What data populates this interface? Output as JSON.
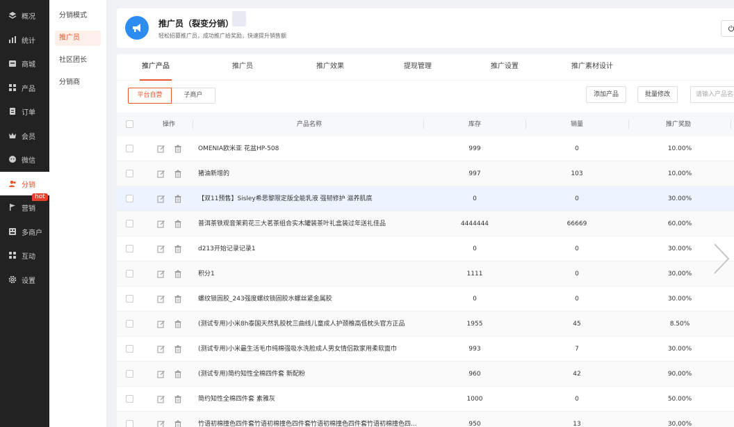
{
  "nav": {
    "items": [
      {
        "label": "概况",
        "icon": "layers-icon"
      },
      {
        "label": "统计",
        "icon": "stats-icon"
      },
      {
        "label": "商城",
        "icon": "shop-icon"
      },
      {
        "label": "产品",
        "icon": "grid-icon"
      },
      {
        "label": "订单",
        "icon": "order-icon"
      },
      {
        "label": "会员",
        "icon": "crown-icon"
      },
      {
        "label": "微信",
        "icon": "chat-icon"
      },
      {
        "label": "分销",
        "icon": "users-icon"
      },
      {
        "label": "营销",
        "icon": "flag-icon"
      },
      {
        "label": "多商户",
        "icon": "store-icon"
      },
      {
        "label": "互动",
        "icon": "apps-icon"
      },
      {
        "label": "设置",
        "icon": "gear-icon"
      }
    ],
    "hot_badge": "hot",
    "active_color": "#e8572b"
  },
  "submenu": {
    "items": [
      "分销模式",
      "推广员",
      "社区团长",
      "分销商"
    ]
  },
  "header": {
    "title": "推广员（裂变分销）",
    "desc": "轻松招募推广员，成功推广给奖励，快速提升销售额"
  },
  "tabs": [
    "推广产品",
    "推广员",
    "推广效果",
    "提现管理",
    "推广设置",
    "推广素材设计"
  ],
  "filters": {
    "segment": [
      "平台自营",
      "子商户"
    ],
    "add_button": "添加产品",
    "batch_button": "批量修改",
    "search_placeholder": "请输入产品名称"
  },
  "table": {
    "headers": {
      "op": "操作",
      "name": "产品名称",
      "stock": "库存",
      "sales": "销量",
      "reward": "推广奖励"
    },
    "rows": [
      {
        "name": "OMENIA欧米亚 花盆HP-508",
        "stock": "999",
        "sales": "0",
        "reward": "10.00%"
      },
      {
        "name": "猪油新增的",
        "stock": "997",
        "sales": "103",
        "reward": "10.00%"
      },
      {
        "name": "【双11预售】Sisley希思黎限定版全能乳液 强韧修护 滋养肌底",
        "stock": "0",
        "sales": "0",
        "reward": "30.00%"
      },
      {
        "name": "普洱茶铁观音茉莉花三大茗茶组合实木罐装茶叶礼盒装过年送礼佳品",
        "stock": "4444444",
        "sales": "66669",
        "reward": "60.00%"
      },
      {
        "name": "d213开始记录记录1",
        "stock": "0",
        "sales": "0",
        "reward": "30.00%"
      },
      {
        "name": "积分1",
        "stock": "1111",
        "sales": "0",
        "reward": "30.00%"
      },
      {
        "name": "螺纹锁固胶_243强度螺纹锁固胶水螺丝紧金属胶",
        "stock": "0",
        "sales": "0",
        "reward": "30.00%"
      },
      {
        "name": "(测试专用)小米8h泰国天然乳胶枕三曲线儿童成人护颈椎高低枕头官方正品",
        "stock": "1955",
        "sales": "45",
        "reward": "8.50%"
      },
      {
        "name": "(测试专用)小米最生活毛巾纯棉强吸水洗脸成人男女情侣款家用柔软面巾",
        "stock": "993",
        "sales": "7",
        "reward": "30.00%"
      },
      {
        "name": "(测试专用)简约知性全棉四件套 新配粉",
        "stock": "960",
        "sales": "42",
        "reward": "90.00%"
      },
      {
        "name": "简约知性全棉四件套 素雅灰",
        "stock": "1000",
        "sales": "0",
        "reward": "50.00%"
      },
      {
        "name": "竹语初棉撞色四件套竹语初棉撞色四件套竹语初棉撞色四件套竹语初棉撞色四...",
        "stock": "950",
        "sales": "13",
        "reward": "30.00%"
      }
    ]
  }
}
